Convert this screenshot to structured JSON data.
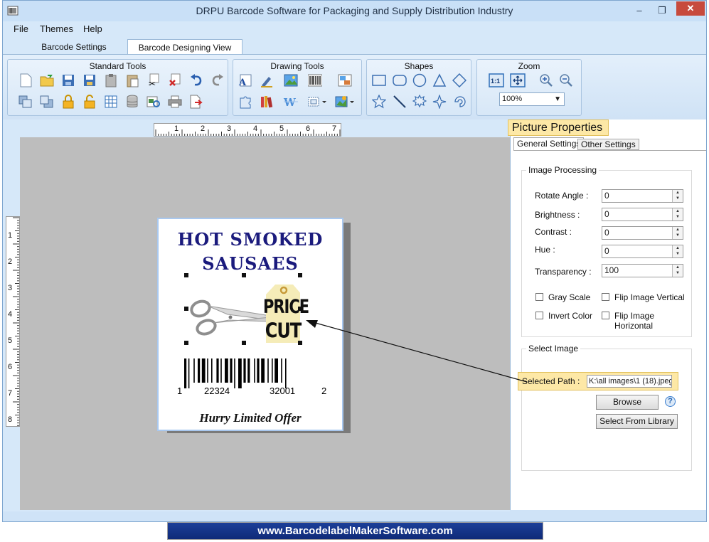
{
  "window": {
    "title": "DRPU Barcode Software for Packaging and Supply Distribution Industry",
    "minimize": "–",
    "restore": "❐",
    "close": "✕"
  },
  "menu": [
    "File",
    "Themes",
    "Help"
  ],
  "main_tabs": [
    "Barcode Settings",
    "Barcode Designing View"
  ],
  "ribbon": {
    "groups": {
      "standard": "Standard Tools",
      "drawing": "Drawing Tools",
      "shapes": "Shapes",
      "zoom": "Zoom"
    },
    "zoom_value": "100%"
  },
  "rulers": {
    "horizontal": [
      "1",
      "2",
      "3",
      "4",
      "5",
      "6",
      "7"
    ],
    "vertical": [
      "1",
      "2",
      "3",
      "4",
      "5",
      "6",
      "7",
      "8"
    ]
  },
  "label": {
    "title_line1": "HOT  SMOKED",
    "title_line2": "SAUSAES",
    "tag_line1": "PRICE",
    "tag_line2": "CUT",
    "barcode_digits": [
      "1",
      "22324",
      "32001",
      "2"
    ],
    "offer": "Hurry Limited Offer"
  },
  "properties": {
    "title": "Picture Properties",
    "tabs": [
      "General Settings",
      "Other Settings"
    ],
    "image_processing": {
      "legend": "Image Processing",
      "rotate_label": "Rotate Angle :",
      "rotate_value": "0",
      "brightness_label": "Brightness     :",
      "brightness_value": "0",
      "contrast_label": "Contrast        :",
      "contrast_value": "0",
      "hue_label": "Hue               :",
      "hue_value": "0",
      "transparency_label": "Transparency :",
      "transparency_value": "100",
      "gray_scale": "Gray Scale",
      "invert_color": "Invert Color",
      "flip_vertical": "Flip Image Vertical",
      "flip_horizontal": "Flip Image Horizontal"
    },
    "select_image": {
      "legend": "Select Image",
      "path_label": "Selected Path :",
      "path_value": "K:\\all images\\1 (18).jpeg",
      "browse": "Browse",
      "help": "?",
      "library": "Select From Library"
    }
  },
  "footer": "www.BarcodelabelMakerSoftware.com",
  "colors": {
    "label_title": "#1b1b7d",
    "highlight": "#fde8a6",
    "footer_bg": "#1c3f99",
    "close_button": "#c74a3d"
  }
}
